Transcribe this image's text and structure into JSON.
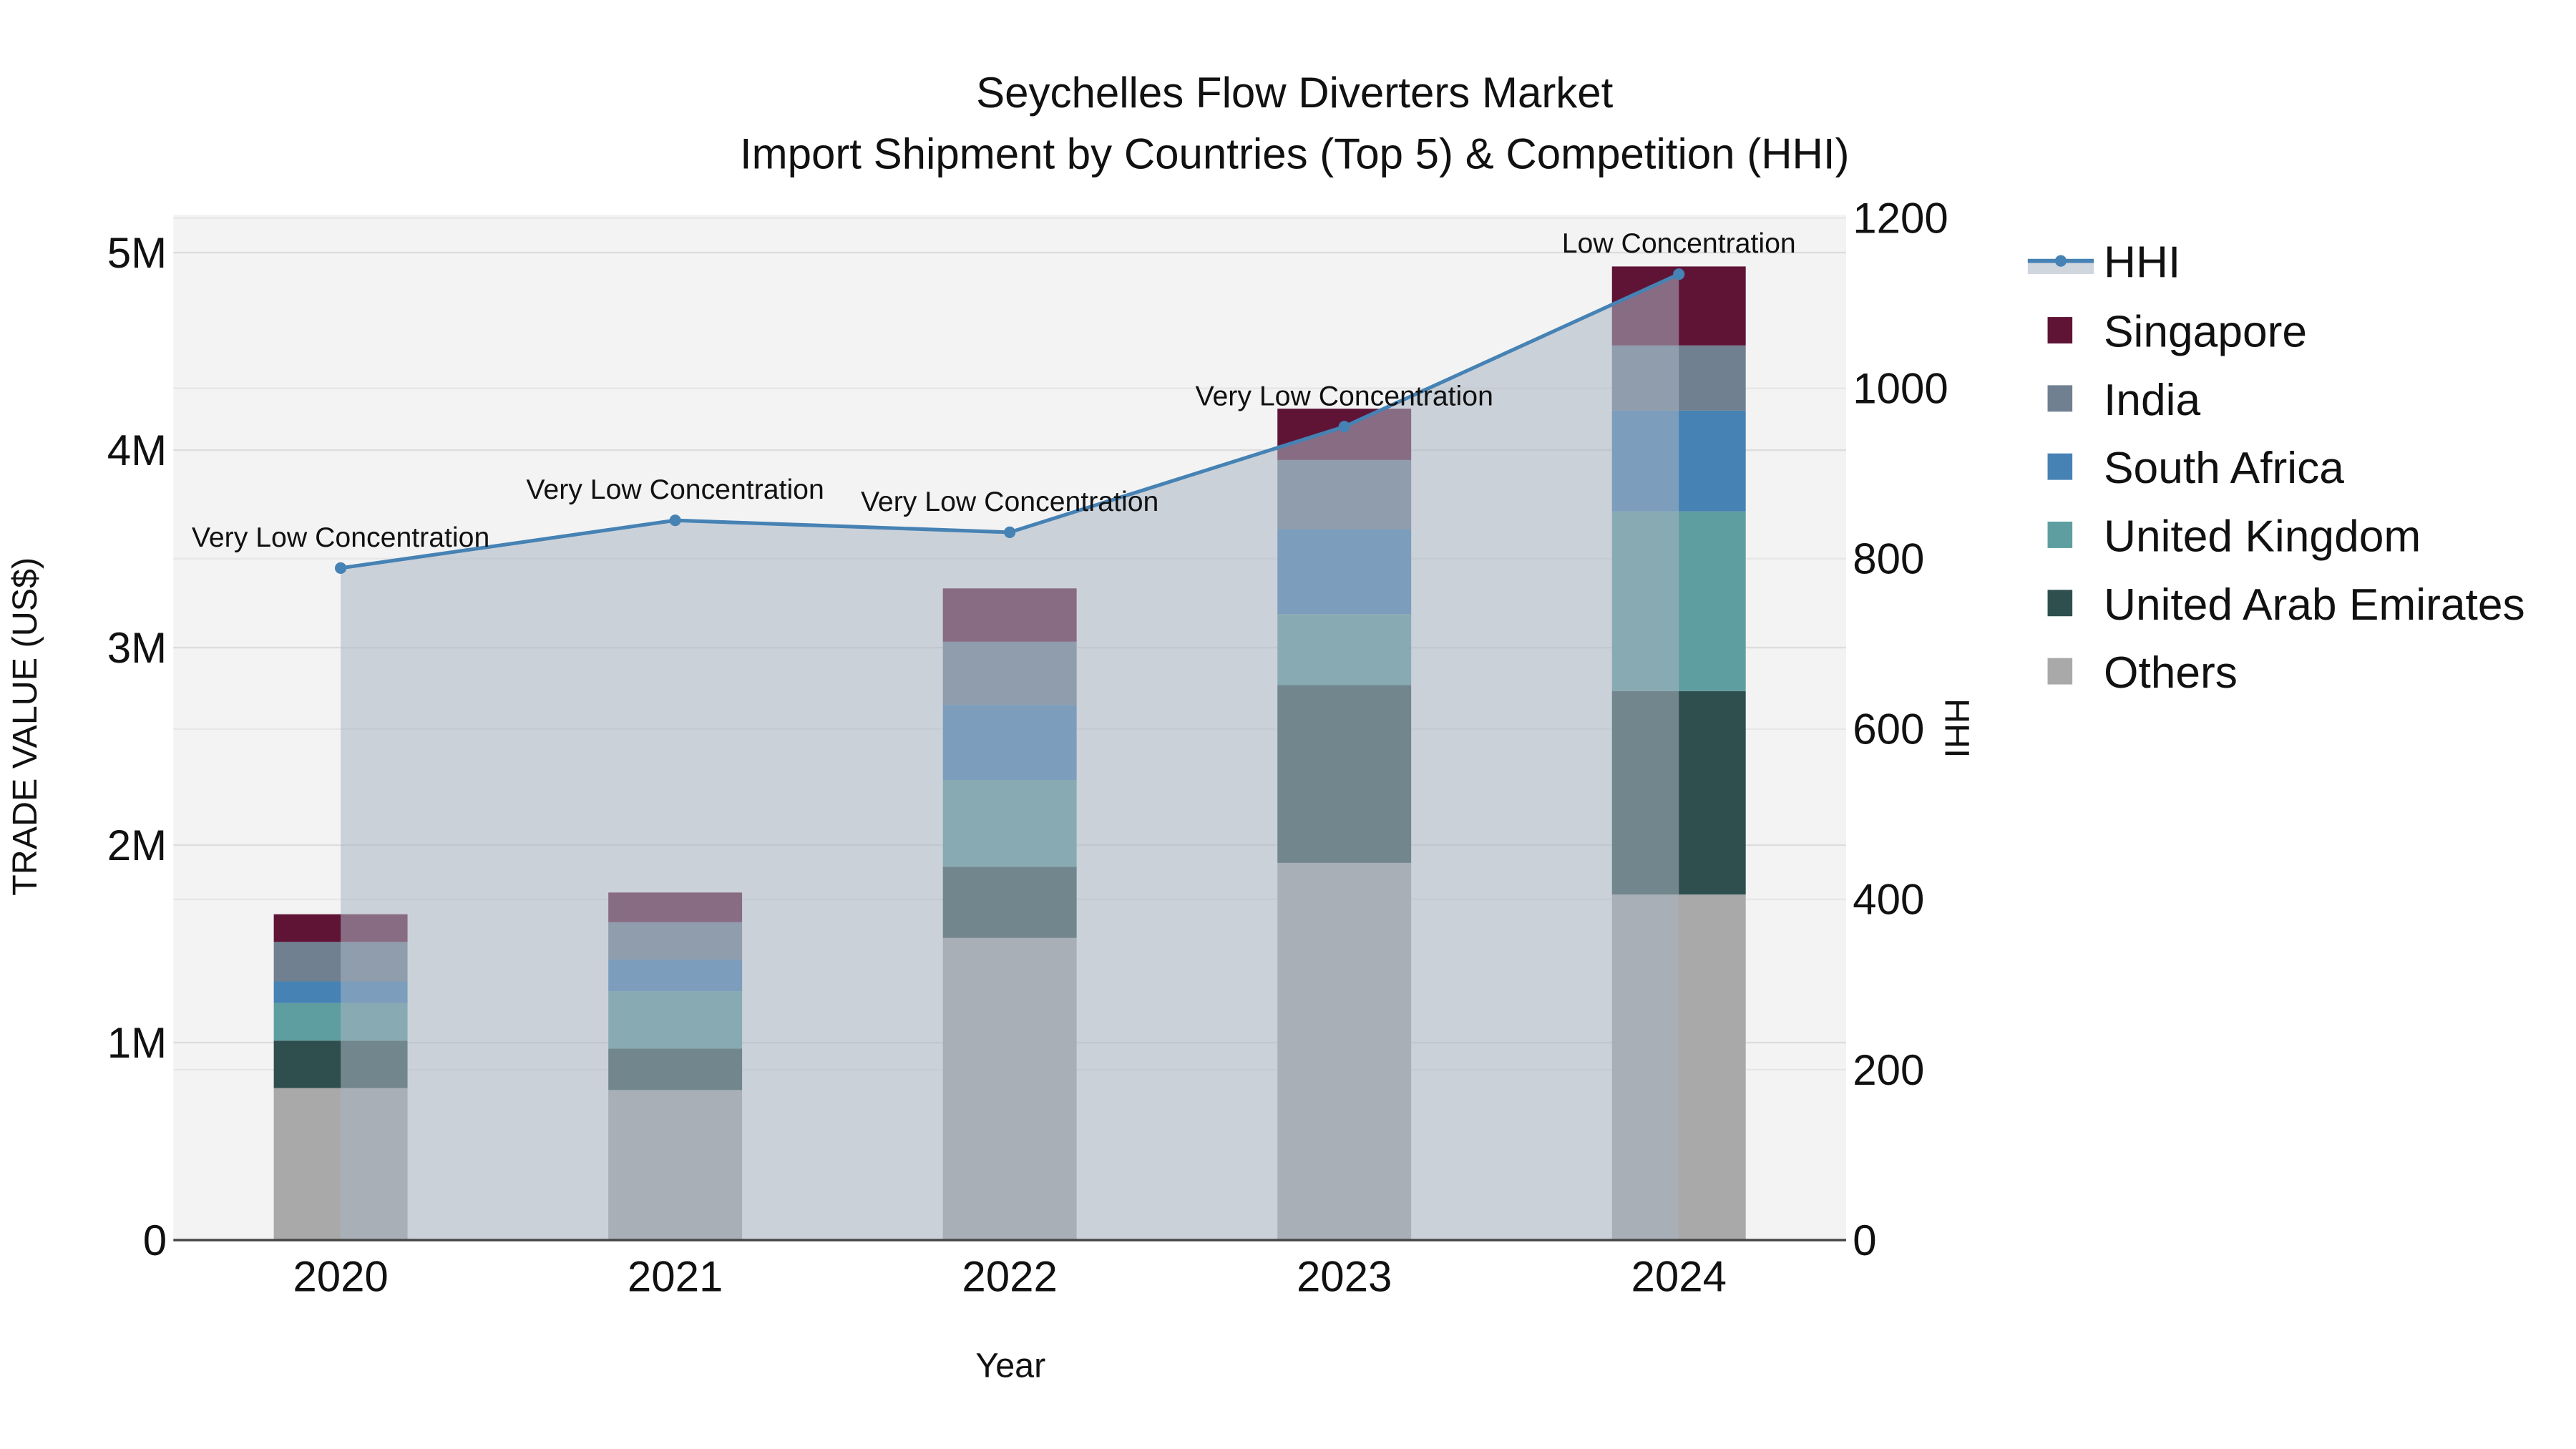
{
  "chart_data": {
    "type": "bar",
    "stacked": true,
    "title": "Seychelles Flow Diverters Market",
    "subtitle": "Import Shipment by Countries (Top 5) & Competition (HHI)",
    "xlabel": "Year",
    "ylabel": "TRADE VALUE (US$)",
    "y2label": "HHI",
    "categories": [
      "2020",
      "2021",
      "2022",
      "2023",
      "2024"
    ],
    "ylim": [
      0,
      5200000
    ],
    "y_ticks": [
      0,
      1000000,
      2000000,
      3000000,
      4000000,
      5000000
    ],
    "y_tick_labels": [
      "0",
      "1M",
      "2M",
      "3M",
      "4M",
      "5M"
    ],
    "y2lim": [
      0,
      1200
    ],
    "y2_ticks": [
      0,
      200,
      400,
      600,
      800,
      1000,
      1200
    ],
    "y2_tick_labels": [
      "0",
      "200",
      "400",
      "600",
      "800",
      "1000",
      "1200"
    ],
    "grid": true,
    "legend_position": "right",
    "series": [
      {
        "name": "Others",
        "color": "#a9a9a9",
        "values": [
          770000,
          760000,
          1530000,
          1910000,
          1750000
        ]
      },
      {
        "name": "United Arab Emirates",
        "color": "#2f4f4f",
        "values": [
          240000,
          210000,
          360000,
          900000,
          1030000
        ]
      },
      {
        "name": "United Kingdom",
        "color": "#5f9ea0",
        "values": [
          190000,
          290000,
          440000,
          360000,
          910000
        ]
      },
      {
        "name": "South Africa",
        "color": "#4682b4",
        "values": [
          110000,
          160000,
          380000,
          430000,
          510000
        ]
      },
      {
        "name": "India",
        "color": "#708090",
        "values": [
          200000,
          190000,
          320000,
          350000,
          330000
        ]
      },
      {
        "name": "Singapore",
        "color": "#5f1436",
        "values": [
          140000,
          150000,
          270000,
          260000,
          400000
        ]
      }
    ],
    "hhi": {
      "name": "HHI",
      "color": "#4682b4",
      "values": [
        789,
        845,
        831,
        955,
        1134
      ],
      "annotations": [
        "Very Low Concentration",
        "Very Low Concentration",
        "Very Low Concentration",
        "Very Low Concentration",
        "Low Concentration"
      ]
    },
    "legend": [
      "HHI",
      "Singapore",
      "India",
      "South Africa",
      "United Kingdom",
      "United Arab Emirates",
      "Others"
    ]
  }
}
